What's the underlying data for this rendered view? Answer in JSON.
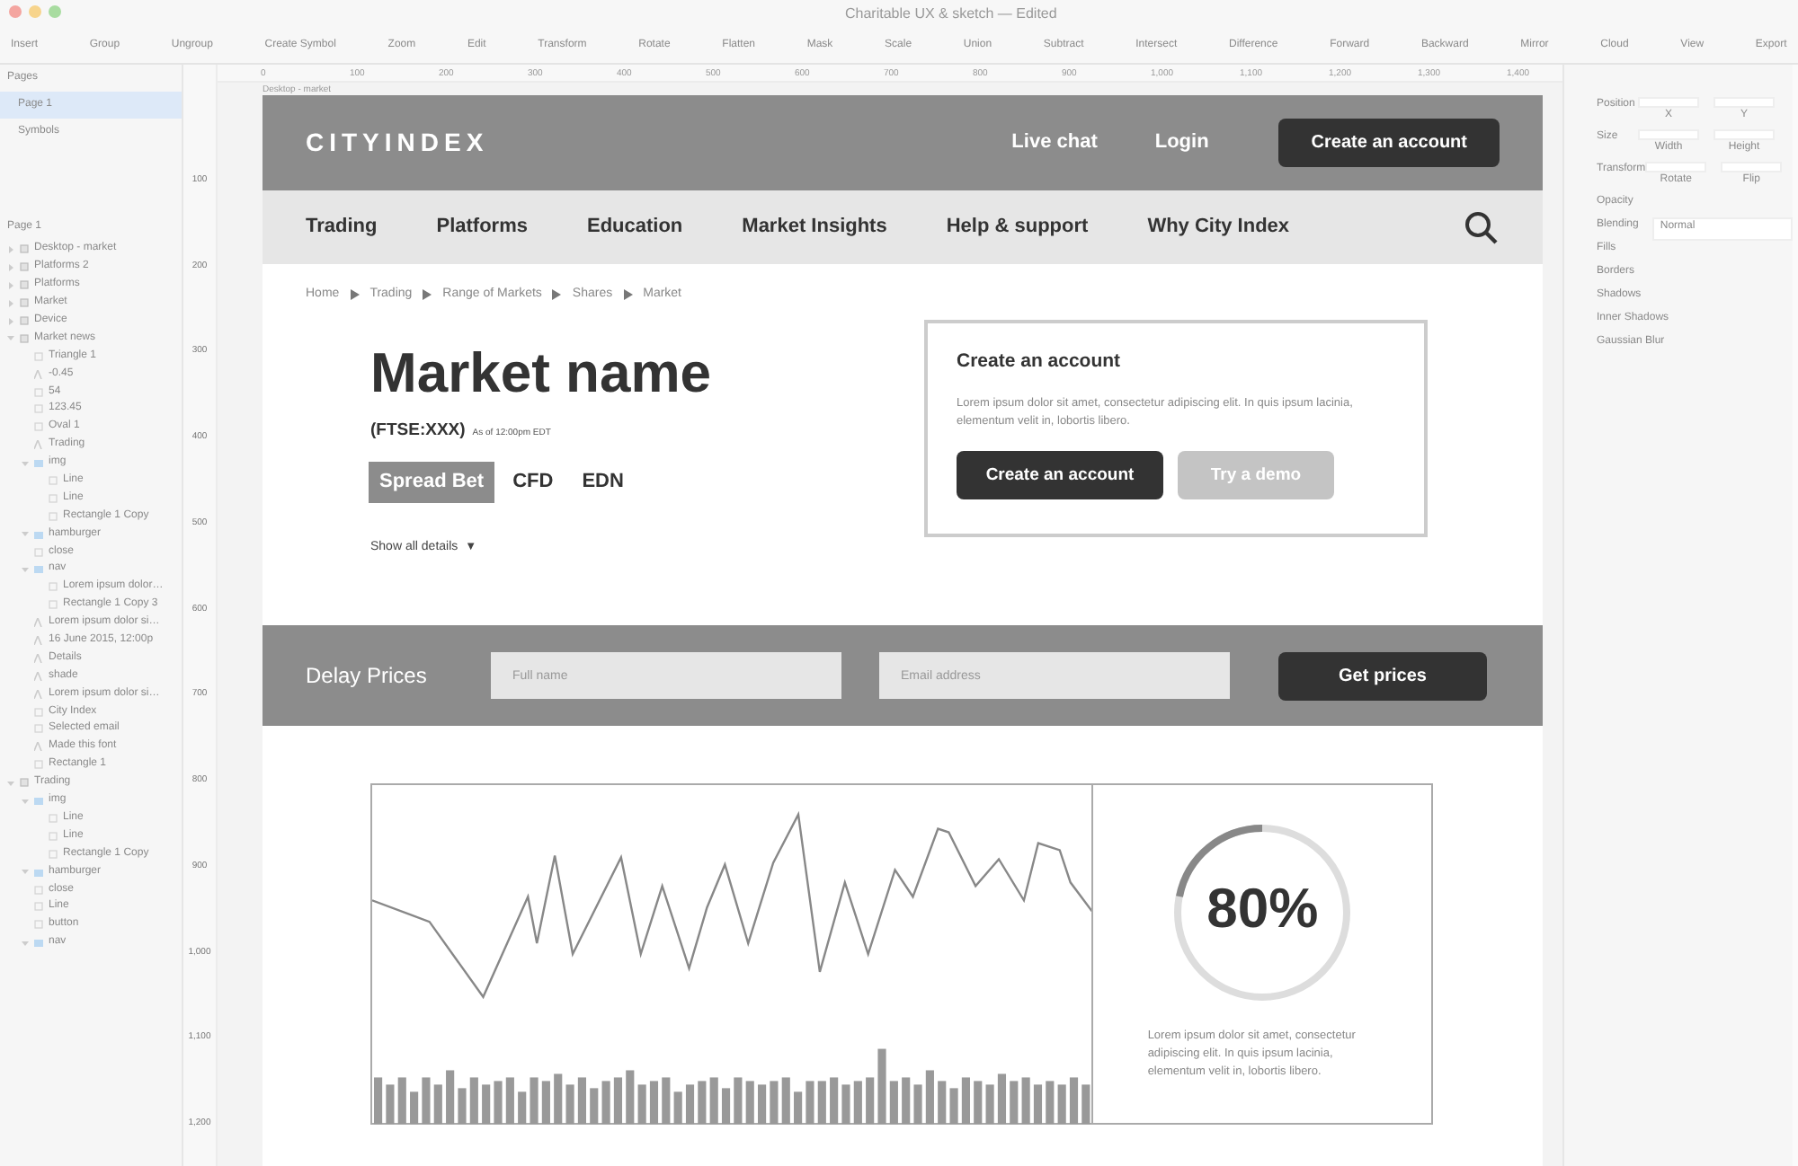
{
  "window": {
    "title": "Charitable UX & sketch — Edited"
  },
  "toolbar": [
    "Insert",
    "Group",
    "Ungroup",
    "Create Symbol",
    "Zoom",
    "Edit",
    "Transform",
    "Rotate",
    "Flatten",
    "Mask",
    "Scale",
    "Union",
    "Subtract",
    "Intersect",
    "Difference",
    "Forward",
    "Backward",
    "Mirror",
    "Cloud",
    "View",
    "Export"
  ],
  "ruler": {
    "horizontal": [
      "0",
      "100",
      "200",
      "300",
      "400",
      "500",
      "600",
      "700",
      "800",
      "900",
      "1,000",
      "1,100",
      "1,200",
      "1,300",
      "1,400"
    ],
    "vertical": [
      "100",
      "200",
      "300",
      "400",
      "500",
      "600",
      "700",
      "800",
      "900",
      "1,000",
      "1,100",
      "1,200"
    ]
  },
  "pages": {
    "title": "Pages",
    "items": [
      {
        "label": "Page 1",
        "selected": true
      },
      {
        "label": "Symbols",
        "selected": false
      }
    ]
  },
  "layers": {
    "title": "Page 1",
    "items": [
      {
        "label": "Desktop - market",
        "kind": "artboard",
        "expanded": false
      },
      {
        "label": "Platforms 2",
        "kind": "artboard",
        "expanded": false
      },
      {
        "label": "Platforms",
        "kind": "artboard",
        "expanded": false
      },
      {
        "label": "Market",
        "kind": "artboard",
        "expanded": false
      },
      {
        "label": "Device",
        "kind": "artboard",
        "expanded": false
      },
      {
        "label": "Market news",
        "kind": "artboard",
        "expanded": true,
        "children": [
          {
            "label": "Triangle 1",
            "kind": "shape"
          },
          {
            "label": "-0.45",
            "kind": "text"
          },
          {
            "label": "54",
            "kind": "shape"
          },
          {
            "label": "123.45",
            "kind": "shape"
          },
          {
            "label": "Oval 1",
            "kind": "shape"
          },
          {
            "label": "Trading",
            "kind": "text"
          },
          {
            "label": "img",
            "kind": "group",
            "expanded": true,
            "children": [
              {
                "label": "Line",
                "kind": "shape"
              },
              {
                "label": "Line",
                "kind": "shape"
              },
              {
                "label": "Rectangle 1 Copy",
                "kind": "shape"
              }
            ]
          },
          {
            "label": "hamburger",
            "kind": "group",
            "expanded": true
          },
          {
            "label": "close",
            "kind": "shape"
          },
          {
            "label": "nav",
            "kind": "group",
            "expanded": true,
            "children": [
              {
                "label": "Lorem ipsum dolor…",
                "kind": "shape"
              },
              {
                "label": "Rectangle 1 Copy 3",
                "kind": "shape"
              }
            ]
          },
          {
            "label": "Lorem ipsum dolor si…",
            "kind": "text"
          },
          {
            "label": "16 June 2015, 12:00p",
            "kind": "text"
          },
          {
            "label": "Details",
            "kind": "text"
          },
          {
            "label": "shade",
            "kind": "text"
          },
          {
            "label": "Lorem ipsum dolor si…",
            "kind": "text"
          },
          {
            "label": "City Index",
            "kind": "shape"
          },
          {
            "label": "Selected email",
            "kind": "shape"
          },
          {
            "label": "Made this font",
            "kind": "text"
          },
          {
            "label": "Rectangle 1",
            "kind": "shape"
          }
        ]
      },
      {
        "label": "Trading",
        "kind": "artboard",
        "expanded": true,
        "children": [
          {
            "label": "img",
            "kind": "group",
            "expanded": true,
            "children": [
              {
                "label": "Line",
                "kind": "shape"
              },
              {
                "label": "Line",
                "kind": "shape"
              },
              {
                "label": "Rectangle 1 Copy",
                "kind": "shape"
              }
            ]
          },
          {
            "label": "hamburger",
            "kind": "group",
            "expanded": true
          },
          {
            "label": "close",
            "kind": "shape"
          },
          {
            "label": "Line",
            "kind": "shape"
          },
          {
            "label": "button",
            "kind": "shape"
          },
          {
            "label": "nav",
            "kind": "group",
            "expanded": true
          }
        ]
      }
    ]
  },
  "inspector": [
    {
      "label": "Position",
      "sub": [
        "X",
        "Y"
      ]
    },
    {
      "label": "Size",
      "sub": [
        "Width",
        "Height"
      ]
    },
    {
      "label": "Transform",
      "sub": [
        "Rotate",
        "Flip"
      ]
    },
    {
      "label": "Opacity"
    },
    {
      "label": "Blending",
      "value": "Normal"
    },
    {
      "label": "Fills"
    },
    {
      "label": "Borders"
    },
    {
      "label": "Shadows"
    },
    {
      "label": "Inner Shadows"
    },
    {
      "label": "Gaussian Blur"
    }
  ],
  "artboard": {
    "name": "Desktop - market",
    "header": {
      "logo": "CITYINDEX",
      "links": [
        "Live chat",
        "Login"
      ],
      "button": "Create an account"
    },
    "nav": [
      "Trading",
      "Platforms",
      "Education",
      "Market Insights",
      "Help & support",
      "Why City Index"
    ],
    "breadcrumb": [
      "Home",
      "Trading",
      "Range of Markets",
      "Shares",
      "Market"
    ],
    "market": {
      "title": "Market name",
      "symbol": "(FTSE:XXX)",
      "as_of": "As of 12:00pm EDT",
      "tabs": [
        {
          "label": "Spread Bet",
          "selected": true
        },
        {
          "label": "CFD",
          "selected": false
        },
        {
          "label": "EDN",
          "selected": false
        }
      ],
      "details": "Show all details",
      "details_caret": "▼"
    },
    "account_card": {
      "title": "Create an account",
      "text": "Lorem ipsum dolor sit amet, consectetur adipiscing elit. In quis ipsum lacinia, elementum velit in, lobortis libero.",
      "primary": "Create an account",
      "secondary": "Try a demo"
    },
    "delay": {
      "title": "Delay Prices",
      "fields": [
        {
          "placeholder": "Full name"
        },
        {
          "placeholder": "Email address"
        }
      ],
      "button": "Get prices"
    },
    "stats": {
      "percent": "80%",
      "text": "Lorem ipsum dolor sit amet, consectetur adipiscing elit. In quis ipsum lacinia, elementum velit in, lobortis libero."
    }
  }
}
